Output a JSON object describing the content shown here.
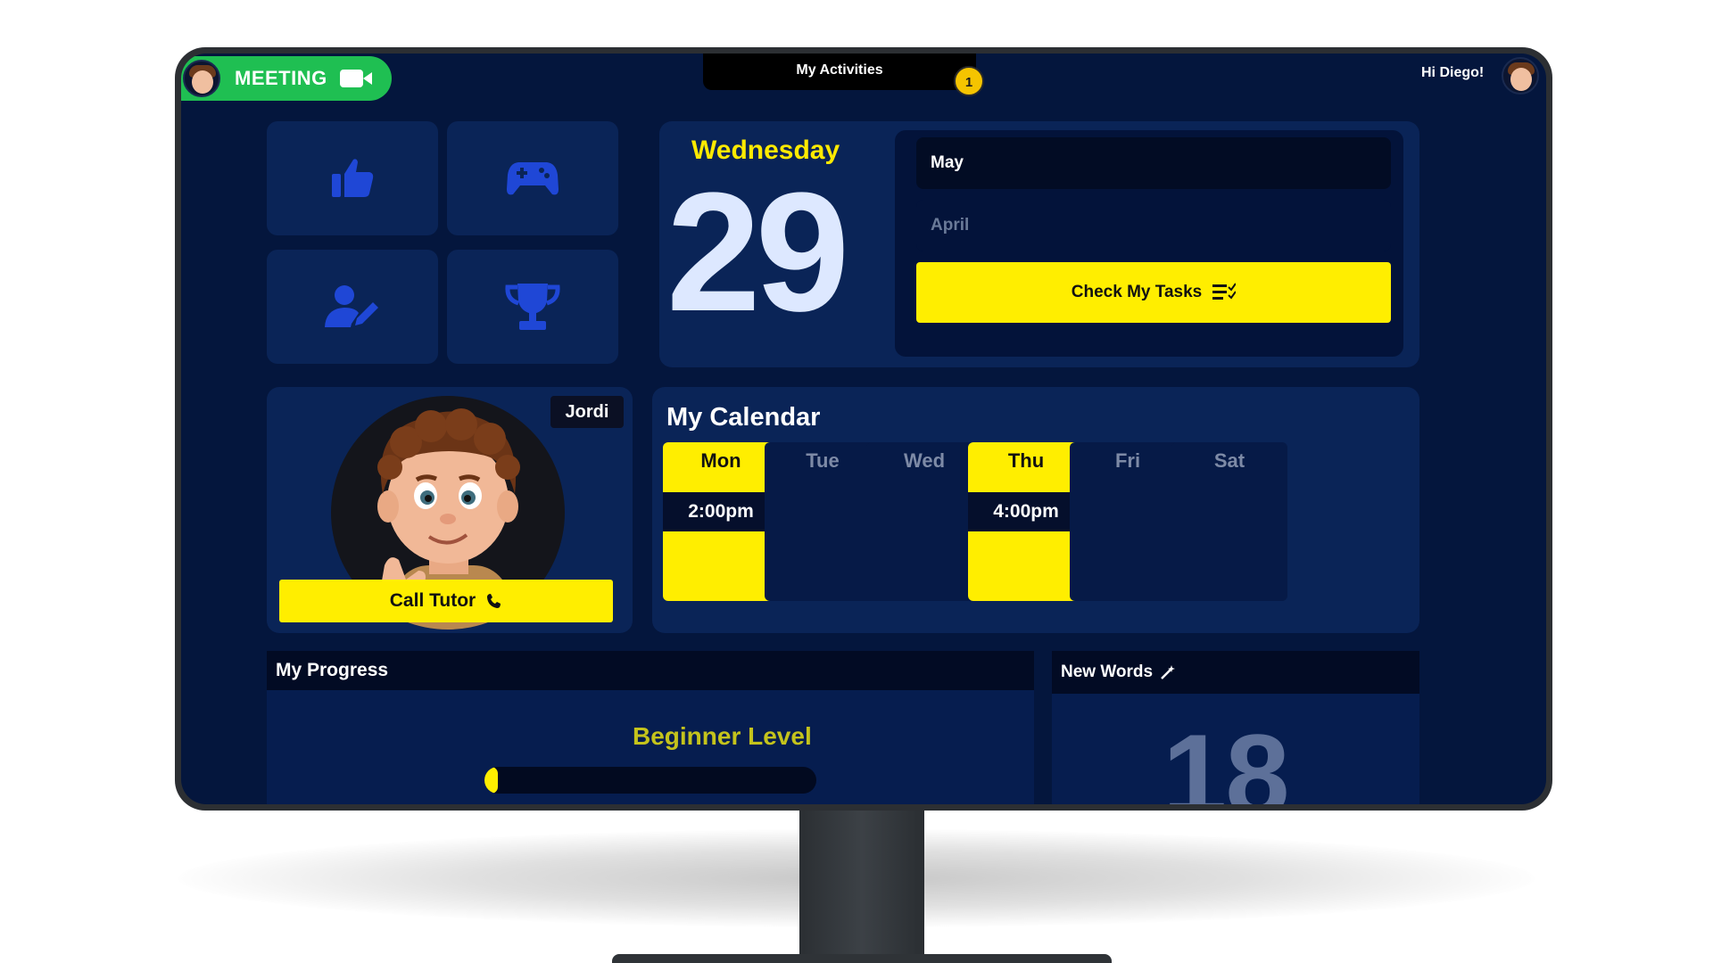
{
  "topbar": {
    "meeting_label": "MEETING",
    "activities_label": "My Activities",
    "notification_count": "1",
    "greeting": "Hi Diego!"
  },
  "tiles": [
    {
      "icon": "thumbs-up-icon"
    },
    {
      "icon": "gamepad-icon"
    },
    {
      "icon": "user-edit-icon"
    },
    {
      "icon": "trophy-icon"
    }
  ],
  "date": {
    "day_name": "Wednesday",
    "day_number": "29",
    "months": [
      "May",
      "April"
    ],
    "tasks_button": "Check My Tasks"
  },
  "tutor": {
    "name": "Jordi",
    "call_button": "Call Tutor"
  },
  "calendar": {
    "title": "My Calendar",
    "days": [
      {
        "label": "Mon",
        "time": "2:00pm",
        "active": true
      },
      {
        "label": "Tue",
        "time": "",
        "active": false
      },
      {
        "label": "Wed",
        "time": "",
        "active": false
      },
      {
        "label": "Thu",
        "time": "4:00pm",
        "active": true
      },
      {
        "label": "Fri",
        "time": "",
        "active": false
      },
      {
        "label": "Sat",
        "time": "",
        "active": false
      }
    ]
  },
  "progress": {
    "title": "My Progress",
    "level": "Beginner Level",
    "fraction": 0.04
  },
  "new_words": {
    "title": "New Words",
    "count": "18"
  },
  "colors": {
    "background": "#04163d",
    "card": "#0a2457",
    "accent_yellow": "#ffee00",
    "meeting_green": "#1fbf52",
    "icon_blue": "#1f47d6"
  }
}
